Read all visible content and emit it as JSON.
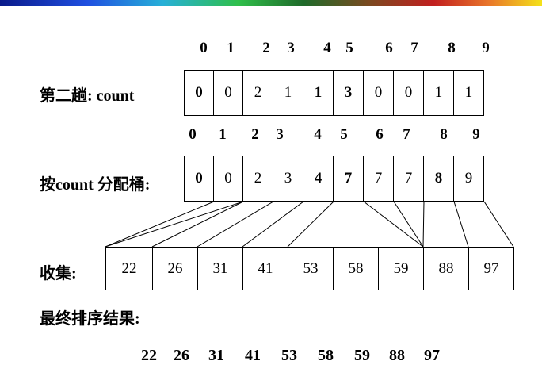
{
  "header_indices": [
    "0",
    "1",
    "2",
    "3",
    "4",
    "5",
    "6",
    "7",
    "8",
    "9"
  ],
  "count_row": {
    "label": "第二趟: count",
    "values": [
      "0",
      "0",
      "2",
      "1",
      "1",
      "3",
      "0",
      "0",
      "1",
      "1"
    ]
  },
  "bucket_row": {
    "label": "按count 分配桶:",
    "values": [
      "0",
      "0",
      "2",
      "3",
      "4",
      "7",
      "7",
      "7",
      "8",
      "9"
    ]
  },
  "collect_row": {
    "label": "收集:",
    "values": [
      "22",
      "26",
      "31",
      "41",
      "53",
      "58",
      "59",
      "88",
      "97"
    ]
  },
  "result": {
    "label": "最终排序结果:",
    "values": [
      "22",
      "26",
      "31",
      "41",
      "53",
      "58",
      "59",
      "88",
      "97"
    ]
  }
}
